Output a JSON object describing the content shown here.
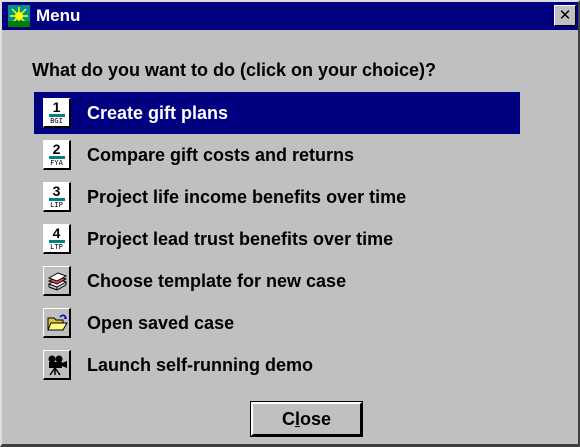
{
  "window": {
    "title": "Menu",
    "close_glyph": "✕",
    "title_bar_color": "#000080",
    "selection_color": "#000080"
  },
  "prompt": "What do you want to do (click on your choice)?",
  "items": [
    {
      "label": "Create gift plans",
      "icon_num": "1",
      "icon_code": "BGI",
      "selected": true
    },
    {
      "label": "Compare gift costs and returns",
      "icon_num": "2",
      "icon_code": "FYA"
    },
    {
      "label": "Project life income benefits over time",
      "icon_num": "3",
      "icon_code": "LIP"
    },
    {
      "label": "Project lead trust benefits over time",
      "icon_num": "4",
      "icon_code": "LTP"
    },
    {
      "label": "Choose template for new case",
      "icon": "template-stack-icon"
    },
    {
      "label": "Open saved case",
      "icon": "folder-open-icon"
    },
    {
      "label": "Launch self-running demo",
      "icon": "movie-camera-icon"
    }
  ],
  "close_button": {
    "label_pre": "C",
    "label_underlined": "l",
    "label_post": "ose"
  }
}
